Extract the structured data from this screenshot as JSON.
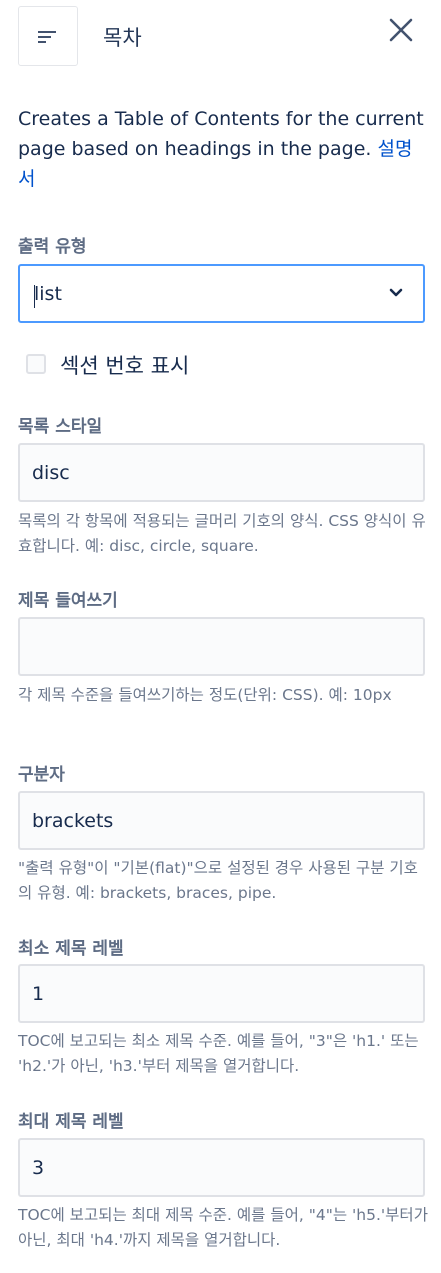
{
  "header": {
    "title": "목차",
    "menu_icon": "sort-lines-icon",
    "close_icon": "close-icon"
  },
  "description": {
    "text": "Creates a Table of Contents for the current page based on headings in the page. ",
    "link": "설명서"
  },
  "output_type": {
    "label": "출력 유형",
    "value": "list"
  },
  "section_numbers": {
    "label": "섹션 번호 표시",
    "checked": false
  },
  "list_style": {
    "label": "목록 스타일",
    "value": "disc",
    "help": "목록의 각 항목에 적용되는 글머리 기호의 양식. CSS 양식이 유효합니다. 예: disc, circle, square."
  },
  "heading_indent": {
    "label": "제목 들여쓰기",
    "value": "",
    "help": "각 제목 수준을 들여쓰기하는 정도(단위: CSS). 예: 10px"
  },
  "separator": {
    "label": "구분자",
    "value": "brackets",
    "help": "\"출력 유형\"이 \"기본(flat)\"으로 설정된 경우 사용된 구분 기호의 유형. 예: brackets, braces, pipe."
  },
  "min_level": {
    "label": "최소 제목 레벨",
    "value": "1",
    "help": "TOC에 보고되는 최소 제목 수준. 예를 들어, \"3\"은 'h1.' 또는 'h2.'가 아닌, 'h3.'부터 제목을 열거합니다."
  },
  "max_level": {
    "label": "최대 제목 레벨",
    "value": "3",
    "help": "TOC에 보고되는 최대 제목 수준. 예를 들어, \"4\"는 'h5.'부터가 아닌, 최대 'h4.'까지 제목을 열거합니다."
  },
  "colors": {
    "focus_border": "#4c9aff",
    "link": "#0052cc",
    "label": "#5e6c84",
    "help": "#6b778c"
  }
}
